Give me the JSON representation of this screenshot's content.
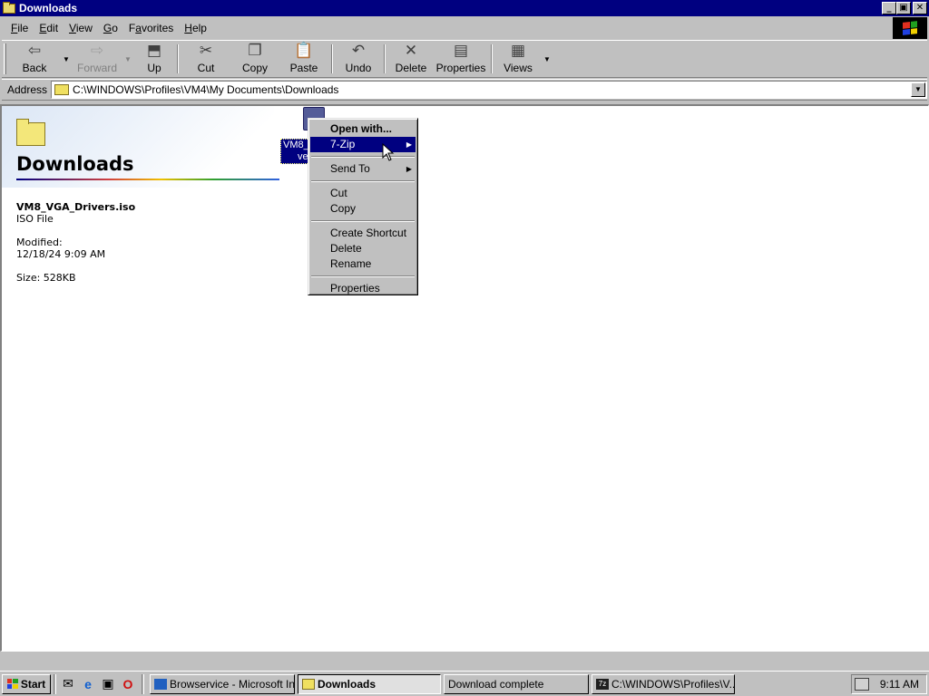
{
  "window": {
    "title": "Downloads",
    "minimize": "_",
    "maximize": "▣",
    "close": "✕"
  },
  "menubar": {
    "items": [
      "File",
      "Edit",
      "View",
      "Go",
      "Favorites",
      "Help"
    ],
    "underline": [
      "F",
      "E",
      "V",
      "G",
      "a",
      "H"
    ]
  },
  "toolbar": {
    "back": "Back",
    "forward": "Forward",
    "up": "Up",
    "cut": "Cut",
    "copy": "Copy",
    "paste": "Paste",
    "undo": "Undo",
    "delete": "Delete",
    "properties": "Properties",
    "views": "Views"
  },
  "address": {
    "label": "Address",
    "value": "C:\\WINDOWS\\Profiles\\VM4\\My Documents\\Downloads"
  },
  "folder_pane": {
    "title": "Downloads",
    "file_name": "VM8_VGA_Drivers.iso",
    "file_type": "ISO File",
    "modified_label": "Modified:",
    "modified_value": "12/18/24 9:09 AM",
    "size": "Size: 528KB"
  },
  "file_icon": {
    "label_line1": "VM8_",
    "label_line2": "ve"
  },
  "context_menu": {
    "open_with": "Open with...",
    "seven_zip": "7-Zip",
    "send_to": "Send To",
    "cut": "Cut",
    "copy": "Copy",
    "create_shortcut": "Create Shortcut",
    "delete": "Delete",
    "rename": "Rename",
    "properties": "Properties"
  },
  "taskbar": {
    "start": "Start",
    "tasks": [
      "Browservice - Microsoft Int...",
      "Downloads",
      "Download complete",
      "C:\\WINDOWS\\Profiles\\V..."
    ],
    "clock": "9:11 AM"
  }
}
